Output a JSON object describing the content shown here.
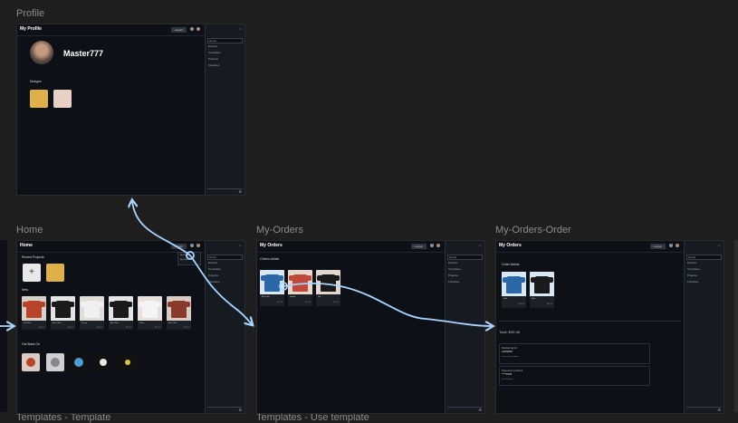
{
  "frames": {
    "profile": {
      "title": "Profile",
      "header": "My Profile",
      "logout": "Logout",
      "username": "Master777",
      "designs_label": "Designs"
    },
    "home": {
      "title": "Home",
      "header": "Home",
      "logout": "Logout",
      "recent_label": "Recent Projects",
      "new_label": "New",
      "sold_label": "Get Back On",
      "add_glyph": "+",
      "cards": [
        {
          "t1": "Red Shirt",
          "t2": "$18.99"
        },
        {
          "t1": "Black Shirt",
          "t2": "$16.99"
        },
        {
          "t1": "Jersey",
          "t2": "$14.99"
        },
        {
          "t1": "Aero Shirt",
          "t2": "$15.99"
        },
        {
          "t1": "Pirate",
          "t2": "$17.99"
        },
        {
          "t1": "Basic Shirt",
          "t2": "$19.99"
        }
      ],
      "popup": [
        "My Profile",
        "My Orders"
      ]
    },
    "orders": {
      "title": "My-Orders",
      "header": "My Orders",
      "logout": "Logout",
      "section_label": "Orders Artists",
      "cards": [
        {
          "t1": "Blue Shirt",
          "t2": "$29.99"
        },
        {
          "t1": "Hoodie",
          "t2": "$18.99"
        },
        {
          "t1": "Tee",
          "t2": "$19.99"
        }
      ]
    },
    "order": {
      "title": "My-Orders-Order",
      "header": "My Orders",
      "logout": "Logout",
      "section_label": "Order Artists",
      "cards": [
        {
          "t1": "Shirt",
          "t2": "$29.99"
        },
        {
          "t1": "Shirt",
          "t2": "$24.99"
        }
      ],
      "total": "Total: $39.98",
      "delivering_label": "Delivering to:",
      "delivering_value": "A009656",
      "delivering_sub": "Lorem ipsum address",
      "payment_label": "Payment method:",
      "payment_value": "****0505",
      "payment_sub": "Visa Standard"
    }
  },
  "sidebar_items": [
    "Home",
    "Explore",
    "Templates",
    "Projects",
    "Favorites"
  ],
  "bottom_frames": {
    "left": "Templates - Template",
    "right": "Templates - Use template"
  },
  "colors": {
    "canvas": "#1e1e1e",
    "frame_bg": "#0d1117",
    "sidebar_bg": "#161b22",
    "arrow": "#a8d4ff"
  },
  "icons": {
    "logout": "logout-button",
    "settings": "gear-icon",
    "avatar": "avatar"
  }
}
